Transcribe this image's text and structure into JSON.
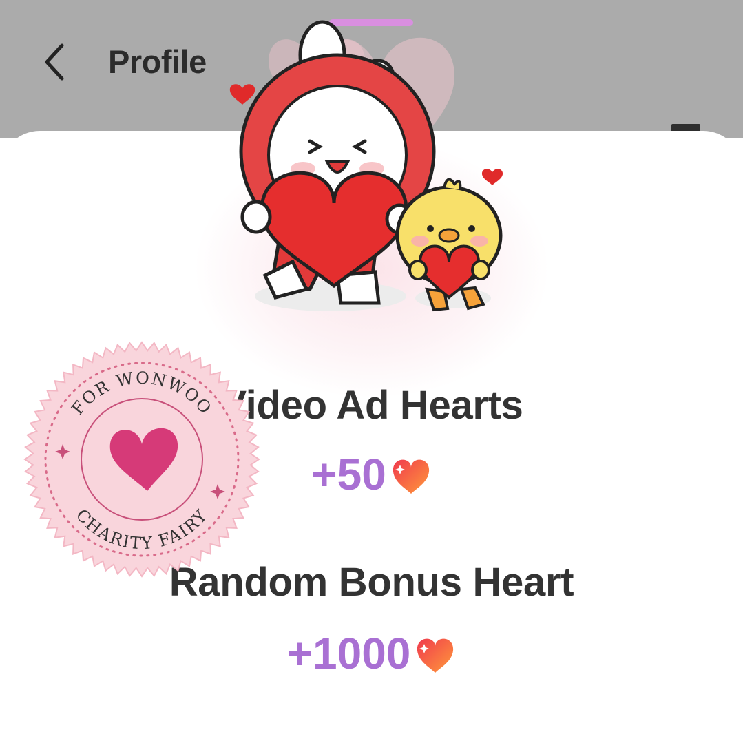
{
  "header": {
    "title": "Profile"
  },
  "rewards": [
    {
      "label": "Video Ad Hearts",
      "amount": "+50"
    },
    {
      "label": "Random Bonus Heart",
      "amount": "+1000"
    }
  ],
  "stamp": {
    "top_text": "FOR WONWOO",
    "bottom_text": "CHARITY FAIRY"
  },
  "icons": {
    "back": "chevron-left-icon",
    "reward": "heart-icon",
    "stamp_center": "heart-icon"
  },
  "colors": {
    "header_bg": "#ababab",
    "accent_purple": "#a970d3",
    "text_dark": "#333333",
    "handle": "#d98fe0",
    "stamp_pink": "#f9d5dc",
    "stamp_heart": "#d63a78"
  }
}
